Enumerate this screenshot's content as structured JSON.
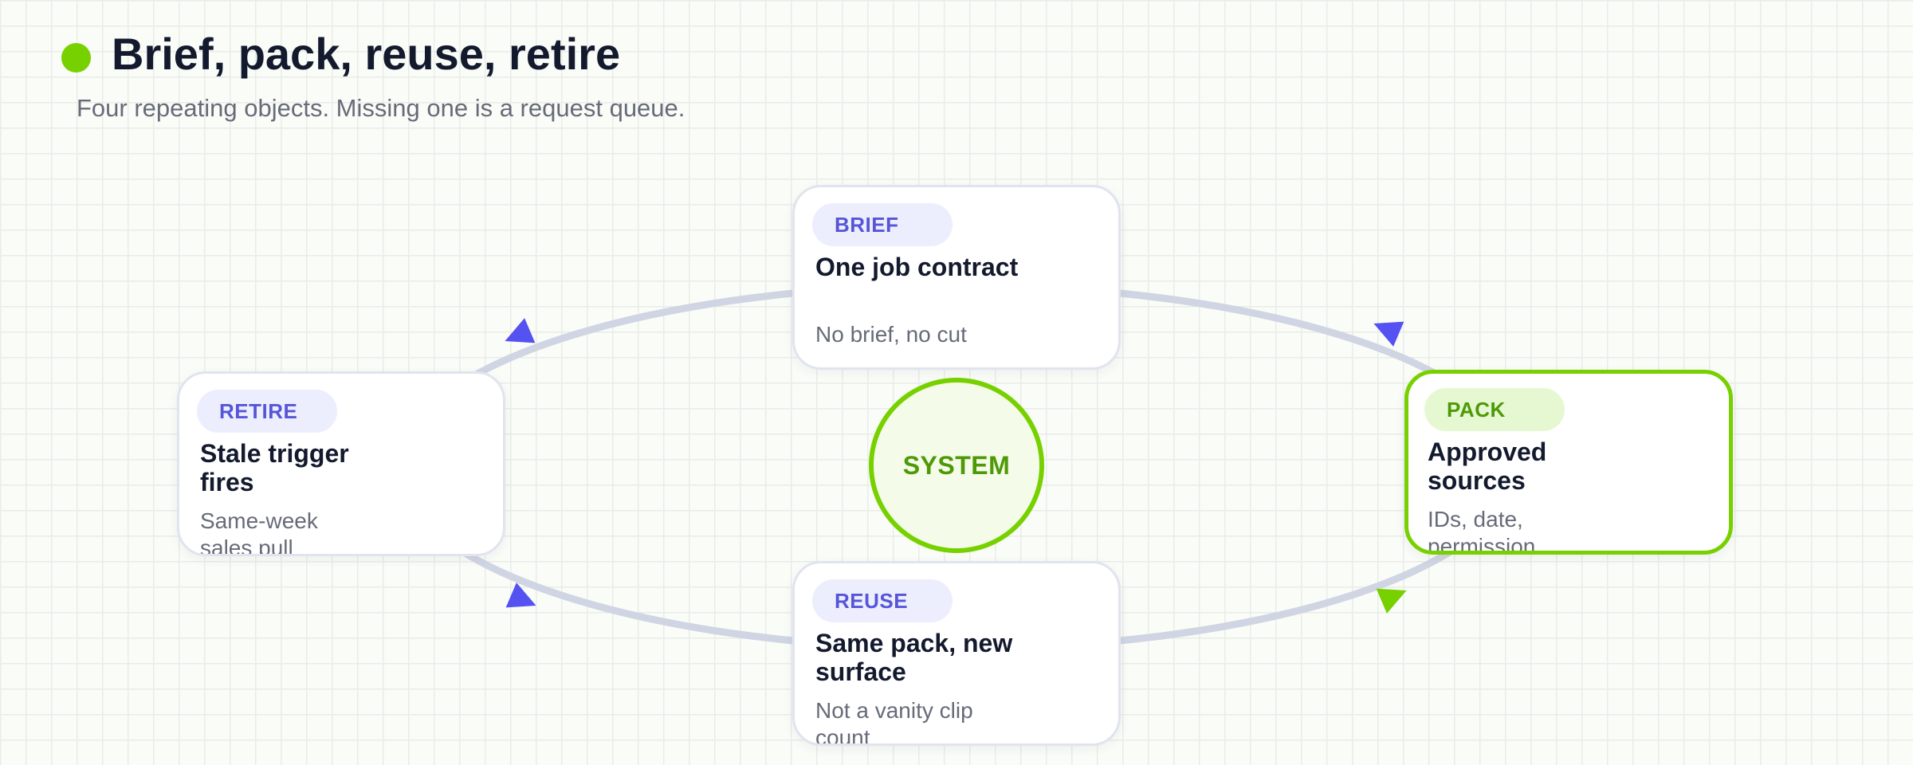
{
  "header": {
    "title": "Brief, pack, reuse, retire",
    "subtitle": "Four repeating objects. Missing one is a request queue.",
    "accent_color": "#77d100"
  },
  "hub": {
    "label": "SYSTEM",
    "color": "#77d100"
  },
  "stages": [
    {
      "id": "brief",
      "tag": "BRIEF",
      "title": "One job contract",
      "description": "No brief, no cut",
      "highlighted": false
    },
    {
      "id": "pack",
      "tag": "PACK",
      "title": "Approved sources",
      "description": "IDs, date, permission",
      "highlighted": true
    },
    {
      "id": "reuse",
      "tag": "REUSE",
      "title": "Same pack, new surface",
      "description": "Not a vanity clip count",
      "highlighted": false
    },
    {
      "id": "retire",
      "tag": "RETIRE",
      "title": "Stale trigger fires",
      "description": "Same-week sales pull",
      "highlighted": false
    }
  ],
  "connectors": [
    {
      "from": "pack",
      "to": "brief",
      "color": "#5552f2"
    },
    {
      "from": "brief",
      "to": "retire",
      "color": "#5552f2"
    },
    {
      "from": "retire",
      "to": "reuse",
      "color": "#5552f2"
    },
    {
      "from": "reuse",
      "to": "pack",
      "color": "#77d100"
    }
  ],
  "colors": {
    "ring": "#cfd5e2",
    "tag_text": "#5655d8",
    "tag_fill": "#eceefe",
    "highlight_tag_text": "#4d9a06",
    "highlight_tag_fill": "#e6f8d2",
    "title_text": "#141a2e",
    "body_text": "#666b78"
  }
}
